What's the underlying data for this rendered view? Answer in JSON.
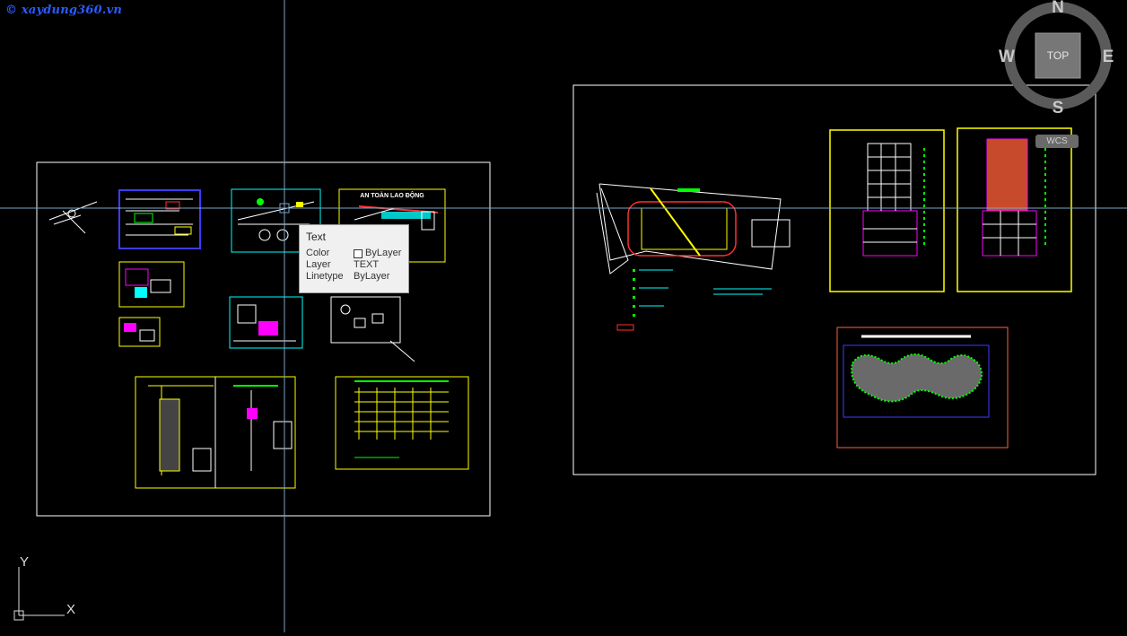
{
  "watermark": "© xaydung360.vn",
  "drawing": {
    "sheet_left_title": "AN TOÀN LAO ĐỘNG"
  },
  "tooltip": {
    "title": "Text",
    "rows": [
      {
        "key": "Color",
        "value": "ByLayer",
        "swatch": true
      },
      {
        "key": "Layer",
        "value": "TEXT"
      },
      {
        "key": "Linetype",
        "value": "ByLayer"
      }
    ]
  },
  "viewcube": {
    "face": "TOP",
    "north": "N",
    "south": "S",
    "east": "E",
    "west": "W",
    "wcs_label": "WCS"
  },
  "ucs": {
    "x_label": "X",
    "y_label": "Y"
  },
  "colors": {
    "background": "#000000",
    "crosshair": "#7aa6c8",
    "frame": "#ffffff",
    "yellow": "#ffff00",
    "cyan": "#00ffff",
    "green": "#00ff00",
    "blue": "#3c3cff",
    "magenta": "#ff00ff",
    "red": "#ff3030"
  }
}
